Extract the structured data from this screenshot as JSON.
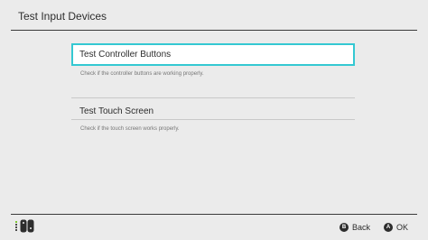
{
  "header": {
    "title": "Test Input Devices"
  },
  "options": [
    {
      "label": "Test Controller Buttons",
      "description": "Check if the controller buttons are working properly.",
      "selected": true
    },
    {
      "label": "Test Touch Screen",
      "description": "Check if the touch screen works properly.",
      "selected": false
    }
  ],
  "footer": {
    "controller_icon": "joycon-icon",
    "back": {
      "glyph": "B",
      "label": "Back"
    },
    "ok": {
      "glyph": "A",
      "label": "OK"
    }
  },
  "colors": {
    "background": "#ebebeb",
    "selection_border": "#34c8d2",
    "player_led": "#7ec832"
  }
}
